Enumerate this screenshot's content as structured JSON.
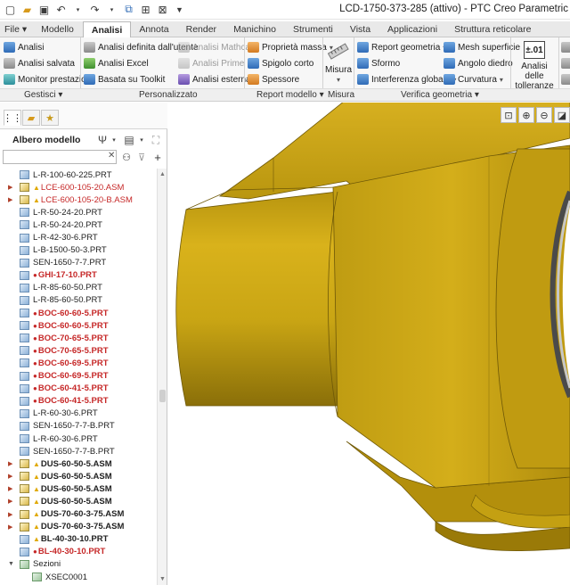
{
  "window": {
    "title": "LCD-1750-373-285 (attivo) - PTC Creo Parametric"
  },
  "quick_access": [
    {
      "name": "new-icon"
    },
    {
      "name": "open-icon"
    },
    {
      "name": "save-icon"
    },
    {
      "name": "undo-icon"
    },
    {
      "name": "redo-icon"
    },
    {
      "name": "regenerate-icon"
    },
    {
      "name": "windows-icon"
    },
    {
      "name": "close-window-icon"
    },
    {
      "name": "customize-icon"
    }
  ],
  "tabs": [
    {
      "label": "File ▾"
    },
    {
      "label": "Modello"
    },
    {
      "label": "Analisi"
    },
    {
      "label": "Annota"
    },
    {
      "label": "Render"
    },
    {
      "label": "Manichino"
    },
    {
      "label": "Strumenti"
    },
    {
      "label": "Vista"
    },
    {
      "label": "Applicazioni"
    },
    {
      "label": "Struttura reticolare"
    }
  ],
  "ribbon": {
    "gestisci": {
      "analisi": "Analisi",
      "analisi_salvata": "Analisi salvata",
      "monitor": "Monitor prestazioni"
    },
    "personalizzato": {
      "definita": "Analisi definita dall'utente",
      "excel": "Analisi Excel",
      "toolkit": "Basata su Toolkit",
      "mathcad": "Analisi Mathcad",
      "prime": "Analisi Prime",
      "esterna": "Analisi esterna"
    },
    "report_modello": {
      "massa": "Proprietà massa",
      "spigolo": "Spigolo corto",
      "spessore": "Spessore"
    },
    "misura": {
      "label": "Misura"
    },
    "verifica": {
      "report_geometria": "Report geometria",
      "sformo": "Sformo",
      "interferenza": "Interferenza globale",
      "mesh": "Mesh superficie",
      "angolo": "Angolo diedro",
      "curvatura": "Curvatura"
    },
    "tolleranze": {
      "badge": "±.01",
      "label_line1": "Analisi delle",
      "label_line2": "tolleranze"
    },
    "group_labels": {
      "gestisci": "Gestisci ▾",
      "personalizzato": "Personalizzato",
      "report_modello": "Report modello ▾",
      "misura": "Misura",
      "verifica": "Verifica geometria ▾"
    }
  },
  "tree_panel": {
    "header": "Albero modello",
    "search_placeholder": "",
    "items": [
      {
        "label": "L-R-100-60-225.PRT",
        "kind": "part",
        "state": "normal"
      },
      {
        "label": "LCE-600-105-20.ASM",
        "kind": "asm",
        "state": "warn-red",
        "expand": true
      },
      {
        "label": "LCE-600-105-20-B.ASM",
        "kind": "asm",
        "state": "warn-red",
        "expand": true
      },
      {
        "label": "L-R-50-24-20.PRT",
        "kind": "part",
        "state": "normal"
      },
      {
        "label": "L-R-50-24-20.PRT",
        "kind": "part",
        "state": "normal"
      },
      {
        "label": "L-R-42-30-6.PRT",
        "kind": "part",
        "state": "normal"
      },
      {
        "label": "L-B-1500-50-3.PRT",
        "kind": "part",
        "state": "normal"
      },
      {
        "label": "SEN-1650-7-7.PRT",
        "kind": "part",
        "state": "normal"
      },
      {
        "label": "GHI-17-10.PRT",
        "kind": "part",
        "state": "error"
      },
      {
        "label": "L-R-85-60-50.PRT",
        "kind": "part",
        "state": "normal"
      },
      {
        "label": "L-R-85-60-50.PRT",
        "kind": "part",
        "state": "normal"
      },
      {
        "label": "BOC-60-60-5.PRT",
        "kind": "part",
        "state": "error"
      },
      {
        "label": "BOC-60-60-5.PRT",
        "kind": "part",
        "state": "error"
      },
      {
        "label": "BOC-70-65-5.PRT",
        "kind": "part",
        "state": "error"
      },
      {
        "label": "BOC-70-65-5.PRT",
        "kind": "part",
        "state": "error"
      },
      {
        "label": "BOC-60-69-5.PRT",
        "kind": "part",
        "state": "error"
      },
      {
        "label": "BOC-60-69-5.PRT",
        "kind": "part",
        "state": "error"
      },
      {
        "label": "BOC-60-41-5.PRT",
        "kind": "part",
        "state": "error"
      },
      {
        "label": "BOC-60-41-5.PRT",
        "kind": "part",
        "state": "error"
      },
      {
        "label": "L-R-60-30-6.PRT",
        "kind": "part",
        "state": "normal"
      },
      {
        "label": "SEN-1650-7-7-B.PRT",
        "kind": "part",
        "state": "normal"
      },
      {
        "label": "L-R-60-30-6.PRT",
        "kind": "part",
        "state": "normal"
      },
      {
        "label": "SEN-1650-7-7-B.PRT",
        "kind": "part",
        "state": "normal"
      },
      {
        "label": "DUS-60-50-5.ASM",
        "kind": "asm",
        "state": "warn-bold",
        "expand": true
      },
      {
        "label": "DUS-60-50-5.ASM",
        "kind": "asm",
        "state": "warn-bold",
        "expand": true
      },
      {
        "label": "DUS-60-50-5.ASM",
        "kind": "asm",
        "state": "warn-bold",
        "expand": true
      },
      {
        "label": "DUS-60-50-5.ASM",
        "kind": "asm",
        "state": "warn-bold",
        "expand": true
      },
      {
        "label": "DUS-70-60-3-75.ASM",
        "kind": "asm",
        "state": "warn-bold",
        "expand": true
      },
      {
        "label": "DUS-70-60-3-75.ASM",
        "kind": "asm",
        "state": "warn-bold",
        "expand": true
      },
      {
        "label": "BL-40-30-10.PRT",
        "kind": "part",
        "state": "warn-bold"
      },
      {
        "label": "BL-40-30-10.PRT",
        "kind": "part",
        "state": "error"
      },
      {
        "label": "Sezioni",
        "kind": "sec",
        "state": "folder",
        "expand": "open"
      },
      {
        "label": "XSEC0001",
        "kind": "sec",
        "state": "child"
      }
    ]
  },
  "colors": {
    "model_body": "#c9a514",
    "model_shadow": "#7a6208",
    "error_text": "#c62828",
    "warning": "#e0a800"
  }
}
